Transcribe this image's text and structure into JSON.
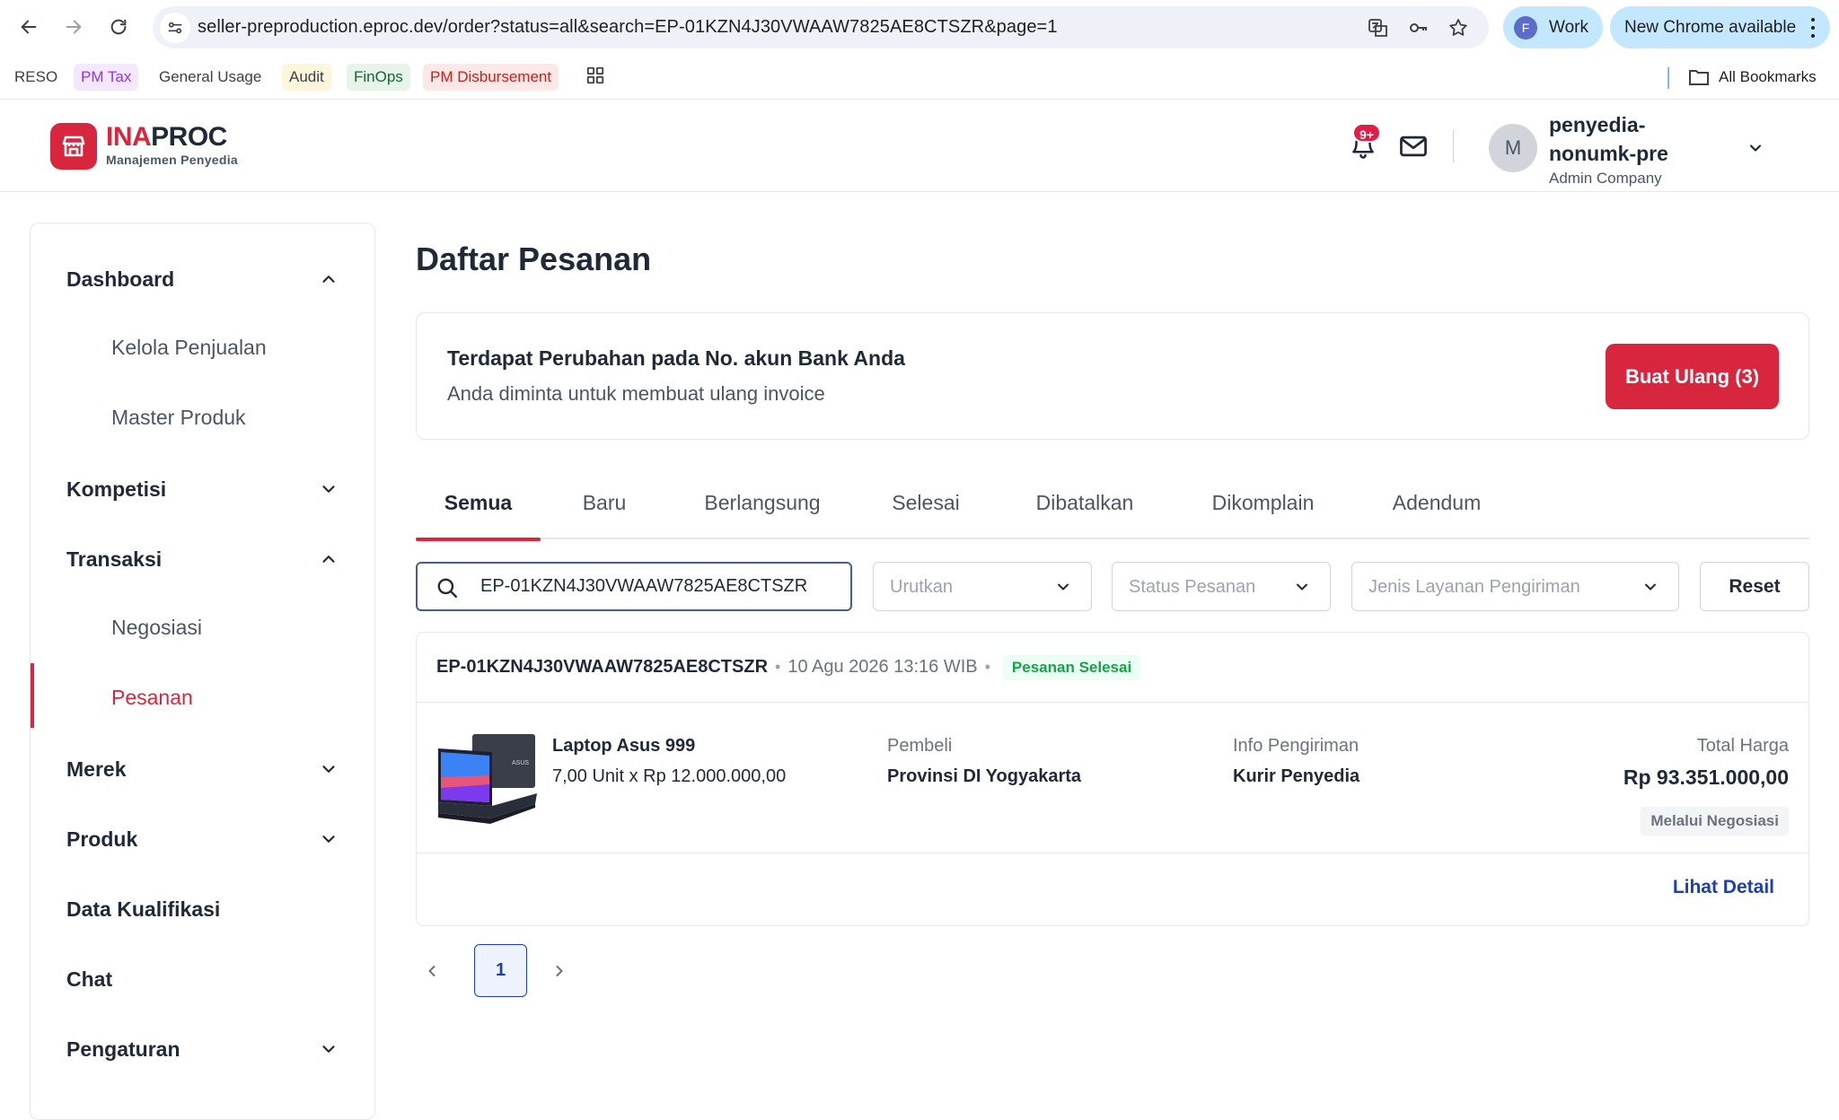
{
  "browser": {
    "url": "seller-preproduction.eproc.dev/order?status=all&search=EP-01KZN4J30VWAAW7825AE8CTSZR&page=1",
    "profile_initial": "F",
    "profile_label": "Work",
    "update_label": "New Chrome available",
    "bookmarks": [
      {
        "label": "RESO",
        "color": "#3c4043",
        "bg": "#ffffff"
      },
      {
        "label": "PM Tax",
        "color": "#9333ea",
        "bg": "#f3e8ff"
      },
      {
        "label": "General Usage",
        "color": "#3c4043",
        "bg": "#ffffff"
      },
      {
        "label": "Audit",
        "color": "#3c4043",
        "bg": "#fdf6dd"
      },
      {
        "label": "FinOps",
        "color": "#166534",
        "bg": "#e6f4ea"
      },
      {
        "label": "PM Disbursement",
        "color": "#c5221f",
        "bg": "#fce8e6"
      }
    ],
    "all_bookmarks_label": "All Bookmarks"
  },
  "header": {
    "logo_ina": "INA",
    "logo_proc": "PROC",
    "logo_sub": "Manajemen Penyedia",
    "notif_count": "9+",
    "user_initial": "M",
    "user_name": "penyedia-nonumk-pre",
    "user_role": "Admin Company"
  },
  "sidebar": {
    "items": [
      {
        "label": "Dashboard",
        "type": "group",
        "expanded": true
      },
      {
        "label": "Kelola Penjualan",
        "type": "sub"
      },
      {
        "label": "Master Produk",
        "type": "sub"
      },
      {
        "label": "Kompetisi",
        "type": "group",
        "expanded": false
      },
      {
        "label": "Transaksi",
        "type": "group",
        "expanded": true
      },
      {
        "label": "Negosiasi",
        "type": "sub"
      },
      {
        "label": "Pesanan",
        "type": "sub",
        "active": true
      },
      {
        "label": "Merek",
        "type": "group",
        "expanded": false
      },
      {
        "label": "Produk",
        "type": "group",
        "expanded": false
      },
      {
        "label": "Data Kualifikasi",
        "type": "link"
      },
      {
        "label": "Chat",
        "type": "link"
      },
      {
        "label": "Pengaturan",
        "type": "group",
        "expanded": false
      }
    ]
  },
  "main": {
    "title": "Daftar Pesanan",
    "alert": {
      "title": "Terdapat Perubahan pada No. akun Bank Anda",
      "subtitle": "Anda diminta untuk membuat ulang invoice",
      "button": "Buat Ulang (3)"
    },
    "tabs": [
      "Semua",
      "Baru",
      "Berlangsung",
      "Selesai",
      "Dibatalkan",
      "Dikomplain",
      "Adendum"
    ],
    "active_tab": "Semua",
    "filters": {
      "search_value": "EP-01KZN4J30VWAAW7825AE8CTSZR",
      "sort_placeholder": "Urutkan",
      "status_placeholder": "Status Pesanan",
      "shipping_placeholder": "Jenis Layanan Pengiriman",
      "reset_label": "Reset"
    },
    "order": {
      "id": "EP-01KZN4J30VWAAW7825AE8CTSZR",
      "date": "10 Agu 2026 13:16 WIB",
      "status": "Pesanan Selesai",
      "product_name": "Laptop Asus 999",
      "product_qty": "7,00 Unit x Rp 12.000.000,00",
      "buyer_label": "Pembeli",
      "buyer_value": "Provinsi DI Yogyakarta",
      "shipping_label": "Info Pengiriman",
      "shipping_value": "Kurir Penyedia",
      "total_label": "Total Harga",
      "total_value": "Rp 93.351.000,00",
      "via_badge": "Melalui Negosiasi",
      "detail_link": "Lihat Detail"
    },
    "pagination": {
      "current": "1"
    }
  },
  "colors": {
    "brand": "#d7263d",
    "link": "#1e40af",
    "success": "#16a34a"
  }
}
